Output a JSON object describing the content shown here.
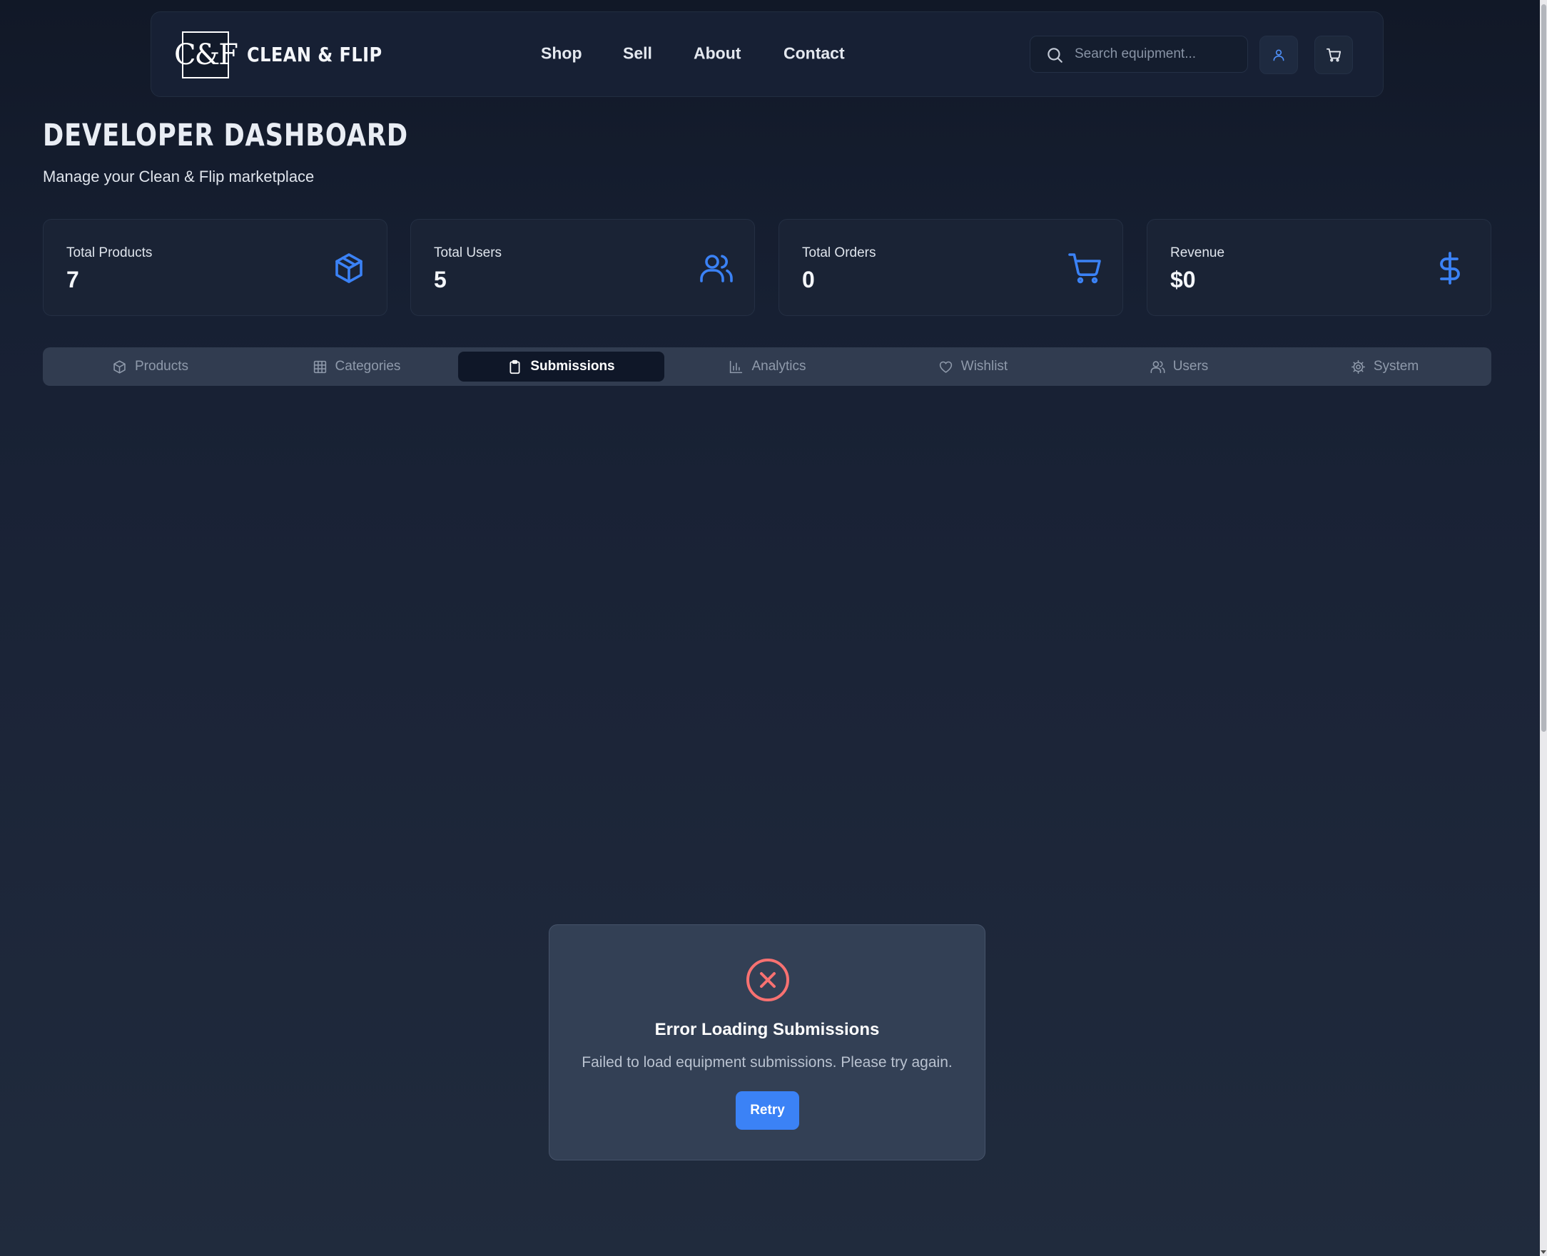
{
  "header": {
    "logo": "C&F",
    "brand": "CLEAN & FLIP",
    "nav": [
      "Shop",
      "Sell",
      "About",
      "Contact"
    ],
    "search_placeholder": "Search equipment...",
    "icons": [
      "user-icon",
      "cart-icon"
    ]
  },
  "page": {
    "title": "DEVELOPER DASHBOARD",
    "subtitle": "Manage your Clean & Flip marketplace"
  },
  "stats": [
    {
      "label": "Total Products",
      "value": "7",
      "icon": "box-icon"
    },
    {
      "label": "Total Users",
      "value": "5",
      "icon": "users-icon"
    },
    {
      "label": "Total Orders",
      "value": "0",
      "icon": "cart-icon"
    },
    {
      "label": "Revenue",
      "value": "$0",
      "icon": "dollar-icon"
    }
  ],
  "tabs": [
    {
      "label": "Products",
      "icon": "box-icon"
    },
    {
      "label": "Categories",
      "icon": "grid-icon"
    },
    {
      "label": "Submissions",
      "icon": "clipboard-icon",
      "active": true
    },
    {
      "label": "Analytics",
      "icon": "bar-chart-icon"
    },
    {
      "label": "Wishlist",
      "icon": "heart-icon"
    },
    {
      "label": "Users",
      "icon": "users-icon"
    },
    {
      "label": "System",
      "icon": "gear-icon"
    }
  ],
  "error": {
    "icon": "x-circle-icon",
    "title": "Error Loading Submissions",
    "message": "Failed to load equipment submissions. Please try again.",
    "retry_label": "Retry"
  },
  "colors": {
    "accent": "#3b82f6",
    "error": "#f87171",
    "background": "#1c2538"
  }
}
